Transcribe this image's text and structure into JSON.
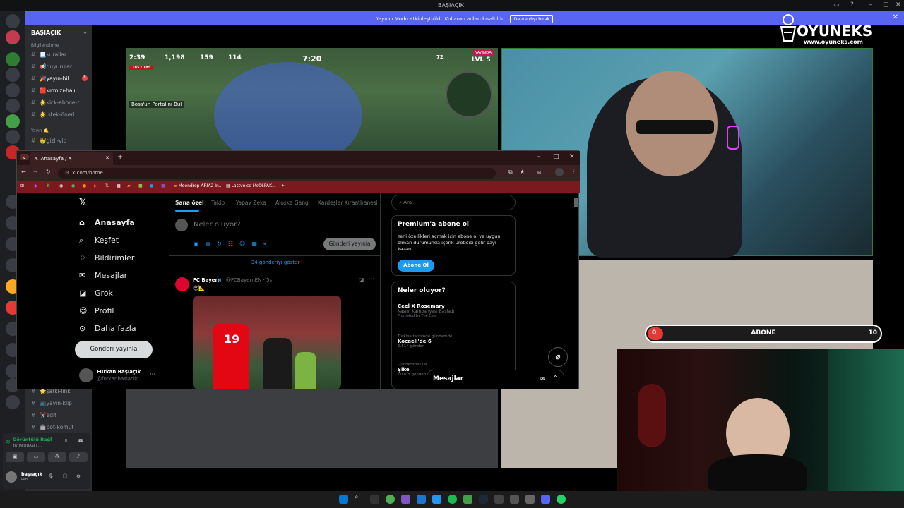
{
  "window": {
    "title": "BAŞIAÇIK"
  },
  "banner": {
    "text": "Yayıncı Modu etkinleştirildi. Kullanıcı adları kısaltıldı.",
    "button": "Devre dışı bırak"
  },
  "server": {
    "name": "BAŞIAÇIK",
    "categories": [
      {
        "label": "Bilgilendirme"
      },
      {
        "label": "Yayın 🔔"
      }
    ],
    "channels": [
      {
        "label": "📃kurallar"
      },
      {
        "label": "📢duyurular"
      },
      {
        "label": "🎉yayın-bil..."
      },
      {
        "label": "🟥kırmızı-halı"
      },
      {
        "label": "🌟kick-abone-r..."
      },
      {
        "label": "🌟istek-öneri"
      },
      {
        "label": "👑gizli-vip"
      },
      {
        "label": "🌟şarkı-link"
      },
      {
        "label": "📺yayın-klip"
      },
      {
        "label": "✂️edit"
      },
      {
        "label": "🤖bot-komut"
      }
    ],
    "badge_count": "8"
  },
  "voice_panel": {
    "status": "Görüntülü Bağl",
    "channel": "YAYIN ODASI / ...",
    "user": "başıaçık",
    "user_status": "Pen..."
  },
  "game": {
    "timer": "7:20",
    "stats": [
      "2:39",
      "1,198",
      "159",
      "114"
    ],
    "hp": "185 / 185",
    "level": "LVL 5",
    "coins": "72",
    "quest": "Boss'un Portalını Bul",
    "live_badge": "YAYINDA"
  },
  "abone_bar": {
    "current": "0",
    "label": "ABONE",
    "goal": "10",
    "progress": 0
  },
  "logo": {
    "name": "OYUNEKS",
    "url": "www.oyuneks.com"
  },
  "browser": {
    "tab_title": "Anasayfa / X",
    "url": "x.com/home",
    "bookmarks": [
      "Moondrop ARIA2 In...",
      "Lastvoice Ms06PAK..."
    ]
  },
  "x": {
    "nav": [
      {
        "label": "Anasayfa",
        "icon": "home-icon"
      },
      {
        "label": "Keşfet",
        "icon": "search-icon"
      },
      {
        "label": "Bildirimler",
        "icon": "bell-icon"
      },
      {
        "label": "Mesajlar",
        "icon": "mail-icon"
      },
      {
        "label": "Grok",
        "icon": "grok-icon"
      },
      {
        "label": "Profil",
        "icon": "person-icon"
      },
      {
        "label": "Daha fazla",
        "icon": "more-icon"
      }
    ],
    "post_button": "Gönderi yayınla",
    "profile": {
      "name": "Furkan Başıaçık",
      "handle": "@furkanbasiacik"
    },
    "feed_tabs": [
      "Sana özel",
      "Takip",
      "Yapay Zeka",
      "Aloske Gang",
      "Kardeşler Kıraathanesi"
    ],
    "compose_placeholder": "Neler oluyor?",
    "compose_button": "Gönderi yayınla",
    "show_posts": "34 gönderiyi göster",
    "post": {
      "author": "FC Bayern",
      "handle": "@FCBayernEN · 5s",
      "text": "😍📐",
      "jersey": "19"
    },
    "search_placeholder": "Ara",
    "premium": {
      "title": "Premium'a abone ol",
      "text": "Yeni özellikleri açmak için abone ol ve uygun olman durumunda içerik üreticisi gelir payı kazan.",
      "button": "Abone Ol"
    },
    "trends": {
      "title": "Neler oluyor?",
      "items": [
        {
          "title": "Ceel X Rosemary",
          "sub": "Kasım Kampanyası Başladı",
          "meta": "Promoted by The Ceel"
        },
        {
          "context": "Türkiye tarihinde gündemde",
          "title": "Kocaeli'de 6",
          "meta": "6.514 gönderi"
        },
        {
          "context": "Gündemdekiler",
          "title": "Şike",
          "meta": "10,8 B gönderi"
        }
      ]
    },
    "messages_label": "Mesajlar"
  }
}
